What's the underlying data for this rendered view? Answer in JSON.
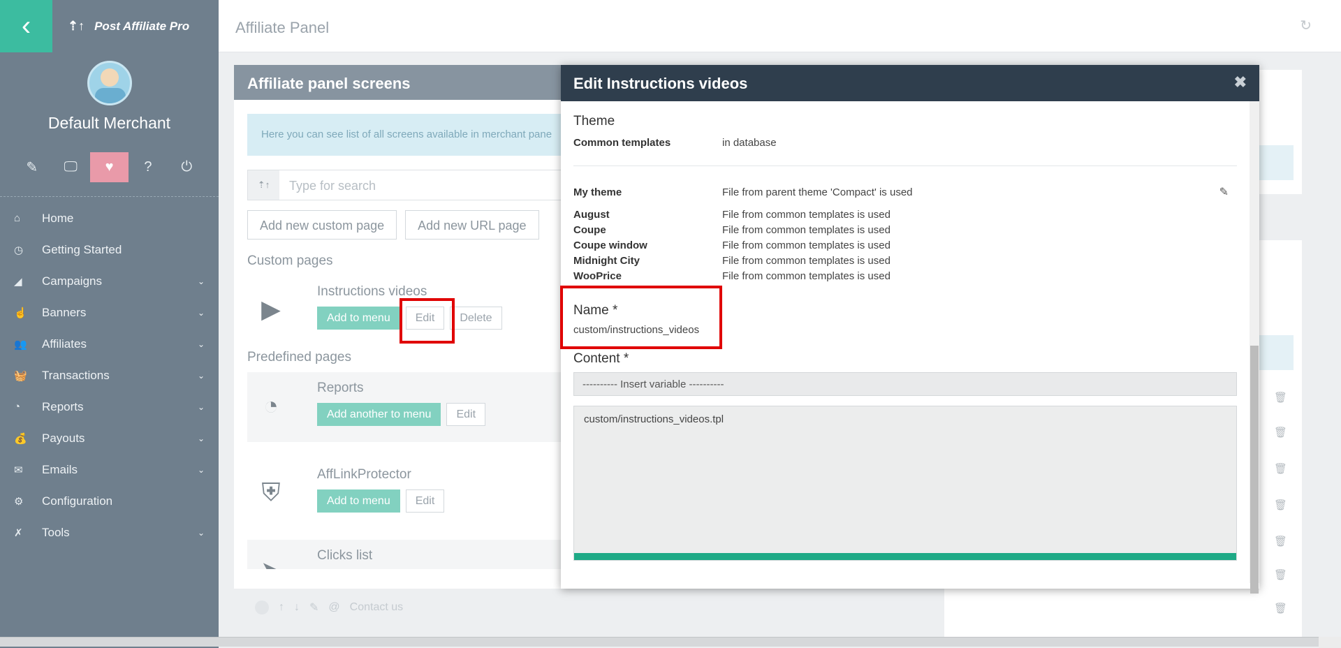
{
  "sidebar": {
    "back_icon": "chevron-left-icon",
    "brand": "Post Affiliate Pro",
    "merchant": "Default Merchant",
    "icon_bar": [
      {
        "name": "pencil-icon",
        "glyph": "✎"
      },
      {
        "name": "monitor-icon",
        "glyph": "🖵"
      },
      {
        "name": "heart-pulse-icon",
        "glyph": "♥"
      },
      {
        "name": "help-icon",
        "glyph": "?"
      },
      {
        "name": "power-icon",
        "glyph": "⏻"
      }
    ],
    "menu": [
      {
        "label": "Home",
        "icon": "home-icon",
        "glyph": "⌂",
        "expandable": false
      },
      {
        "label": "Getting Started",
        "icon": "clock-icon",
        "glyph": "◷",
        "expandable": false
      },
      {
        "label": "Campaigns",
        "icon": "bullhorn-icon",
        "glyph": "◢",
        "expandable": true
      },
      {
        "label": "Banners",
        "icon": "hand-pointer-icon",
        "glyph": "☝",
        "expandable": true
      },
      {
        "label": "Affiliates",
        "icon": "users-icon",
        "glyph": "👥",
        "expandable": true
      },
      {
        "label": "Transactions",
        "icon": "basket-icon",
        "glyph": "🧺",
        "expandable": true
      },
      {
        "label": "Reports",
        "icon": "pie-chart-icon",
        "glyph": "◔",
        "expandable": true
      },
      {
        "label": "Payouts",
        "icon": "money-bag-icon",
        "glyph": "💰",
        "expandable": true
      },
      {
        "label": "Emails",
        "icon": "envelope-icon",
        "glyph": "✉",
        "expandable": true
      },
      {
        "label": "Configuration",
        "icon": "gear-icon",
        "glyph": "⚙",
        "expandable": false
      },
      {
        "label": "Tools",
        "icon": "wrench-icon",
        "glyph": "✗",
        "expandable": true
      }
    ]
  },
  "topbar": {
    "title": "Affiliate Panel",
    "refresh_icon": "↻"
  },
  "panel": {
    "title": "Affiliate panel screens",
    "info": "Here you can see list of all screens available in merchant pane",
    "search_placeholder": "Type for search",
    "add_custom": "Add new custom page",
    "add_url": "Add new URL page",
    "custom_title": "Custom pages",
    "predefined_title": "Predefined pages",
    "custom_pages": [
      {
        "name": "Instructions videos",
        "primary": "Add to menu",
        "edit": "Edit",
        "delete": "Delete"
      }
    ],
    "predefined_pages": [
      {
        "name": "Reports",
        "primary": "Add another to menu",
        "edit": "Edit"
      },
      {
        "name": "AffLinkProtector",
        "primary": "Add to menu",
        "edit": "Edit"
      },
      {
        "name": "Clicks list"
      }
    ]
  },
  "bottom_row": {
    "label": "Contact us"
  },
  "modal": {
    "title": "Edit Instructions videos",
    "close": "✖",
    "theme_heading": "Theme",
    "common_templates": {
      "key": "Common templates",
      "value": "in database"
    },
    "my_theme": {
      "key": "My theme",
      "value": "File from parent theme 'Compact' is used"
    },
    "themes": [
      {
        "key": "August",
        "value": "File from common templates is used"
      },
      {
        "key": "Coupe",
        "value": "File from common templates is used"
      },
      {
        "key": "Coupe window",
        "value": "File from common templates is used"
      },
      {
        "key": "Midnight City",
        "value": "File from common templates is used"
      },
      {
        "key": "WooPrice",
        "value": "File from common templates is used"
      }
    ],
    "name_label": "Name *",
    "name_value": "custom/instructions_videos",
    "content_label": "Content *",
    "insert_variable": "---------- Insert variable ----------",
    "content_value": "custom/instructions_videos.tpl"
  },
  "colors": {
    "accent": "#3cbca0",
    "modal_header": "#2f3e4d",
    "highlight": "#e00000"
  }
}
